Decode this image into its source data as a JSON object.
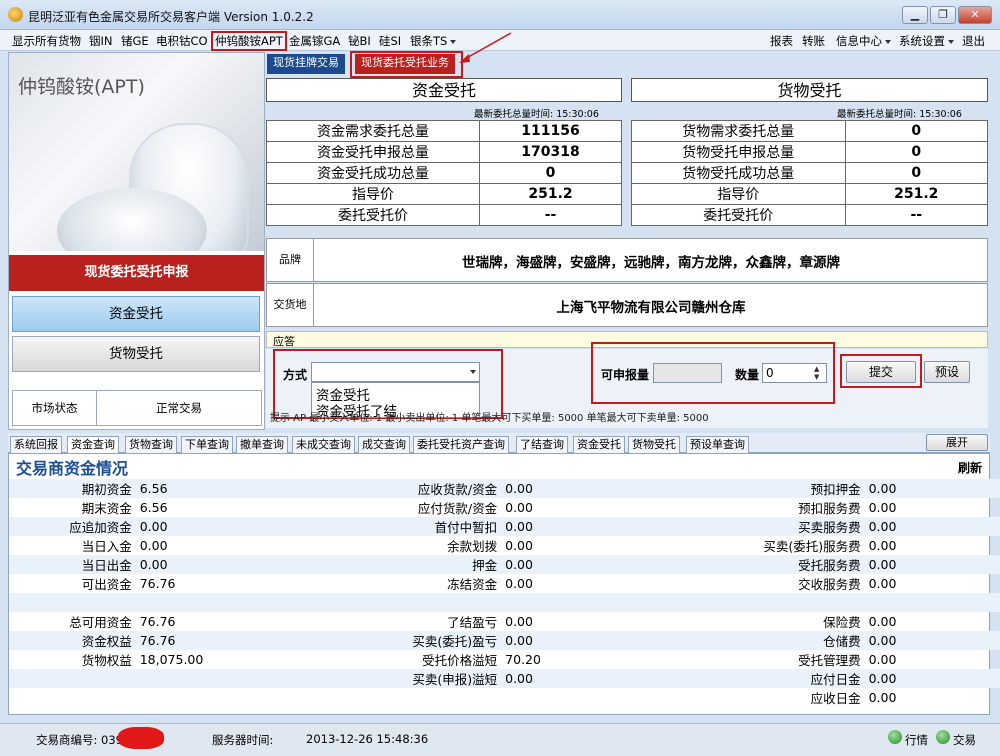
{
  "window": {
    "title": "昆明泛亚有色金属交易所交易客户端 Version 1.0.2.2",
    "controls": [
      "▁",
      "❐",
      "✕"
    ]
  },
  "menu": {
    "left": [
      "显示所有货物",
      "铟IN",
      "锗GE",
      "电积钴CO",
      "仲钨酸铵APT",
      "金属镓GA",
      "铋BI",
      "硅SI",
      "银条TS"
    ],
    "right": [
      "报表",
      "转账",
      "信息中心",
      "系统设置",
      "退出"
    ]
  },
  "product": {
    "name": "仲钨酸铵(APT)"
  },
  "panel_tabs": {
    "listing": "现货挂牌交易",
    "entrust": "现货委托受托业务"
  },
  "left": {
    "apply": "现货委托受托申报",
    "fund_btn": "资金受托",
    "goods_btn": "货物受托",
    "market_label": "市场状态",
    "market_value": "正常交易"
  },
  "fund_side": {
    "title": "资金受托",
    "time_label": "最新委托总量时间: 15:30:06",
    "rows": [
      {
        "label": "资金需求委托总量",
        "value": "111156"
      },
      {
        "label": "资金受托申报总量",
        "value": "170318"
      },
      {
        "label": "资金受托成功总量",
        "value": "0"
      },
      {
        "label": "指导价",
        "value": "251.2"
      },
      {
        "label": "委托受托价",
        "value": "--"
      }
    ]
  },
  "goods_side": {
    "title": "货物受托",
    "time_label": "最新委托总量时间: 15:30:06",
    "rows": [
      {
        "label": "货物需求委托总量",
        "value": "0"
      },
      {
        "label": "货物受托申报总量",
        "value": "0"
      },
      {
        "label": "货物受托成功总量",
        "value": "0"
      },
      {
        "label": "指导价",
        "value": "251.2"
      },
      {
        "label": "委托受托价",
        "value": "--"
      }
    ]
  },
  "brand": {
    "label": "品牌",
    "value": "世瑞牌，海盛牌，安盛牌，远驰牌，南方龙牌，众鑫牌，章源牌"
  },
  "delivery": {
    "label": "交货地",
    "value": "上海飞平物流有限公司赣州仓库"
  },
  "response": {
    "label": "应答"
  },
  "form": {
    "method_label": "方式",
    "method_options": [
      "资金受托",
      "资金受托了结"
    ],
    "avail_label": "可申报量",
    "qty_label": "数量",
    "qty_value": "0",
    "submit": "提交",
    "preset": "预设"
  },
  "hint": {
    "text": "提示   AP  最小交入单位: 1   最小卖出单位: 1    单笔最大可下买单量:  5000   单笔最大可下卖单量:  5000"
  },
  "bottom_tabs": [
    "系统回报",
    "资金查询",
    "货物查询",
    "下单查询",
    "撤单查询",
    "未成交查询",
    "成交查询",
    "委托受托资产查询",
    "了结查询",
    "资金受托",
    "货物受托",
    "预设单查询"
  ],
  "expand": "展开",
  "fund_panel": {
    "title": "交易商资金情况",
    "refresh": "刷新",
    "rows": [
      [
        "期初资金",
        "6.56",
        "应收货款/资金",
        "0.00",
        "预扣押金",
        "0.00"
      ],
      [
        "期末资金",
        "6.56",
        "应付货款/资金",
        "0.00",
        "预扣服务费",
        "0.00"
      ],
      [
        "应追加资金",
        "0.00",
        "首付中暂扣",
        "0.00",
        "买卖服务费",
        "0.00"
      ],
      [
        "当日入金",
        "0.00",
        "余款划拨",
        "0.00",
        "买卖(委托)服务费",
        "0.00"
      ],
      [
        "当日出金",
        "0.00",
        "押金",
        "0.00",
        "受托服务费",
        "0.00"
      ],
      [
        "可出资金",
        "76.76",
        "冻结资金",
        "0.00",
        "交收服务费",
        "0.00"
      ],
      [
        "",
        "",
        "",
        "",
        "",
        ""
      ],
      [
        "总可用资金",
        "76.76",
        "了结盈亏",
        "0.00",
        "保险费",
        "0.00"
      ],
      [
        "资金权益",
        "76.76",
        "买卖(委托)盈亏",
        "0.00",
        "仓储费",
        "0.00"
      ],
      [
        "货物权益",
        "18,075.00",
        "受托价格溢短",
        "70.20",
        "受托管理费",
        "0.00"
      ],
      [
        "",
        "",
        "买卖(申报)溢短",
        "0.00",
        "应付日金",
        "0.00"
      ],
      [
        "",
        "",
        "",
        "",
        "应收日金",
        "0.00"
      ]
    ]
  },
  "status": {
    "trader_label": "交易商编号: 039",
    "server_label": "服务器时间:",
    "server_time": "2013-12-26 15:48:36",
    "quote": "行情",
    "trade": "交易"
  },
  "colors": {
    "accent_red": "#b9211e",
    "accent_blue": "#1d4a8f",
    "title_blue": "#1c4e96"
  }
}
